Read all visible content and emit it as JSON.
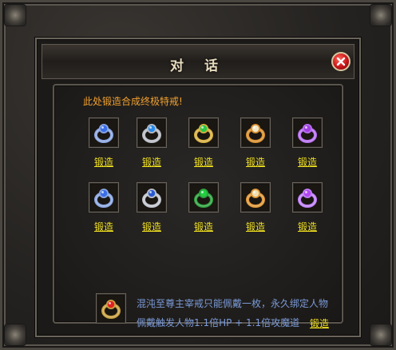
{
  "dialog": {
    "title": "对 话",
    "intro": "此处锻造合成终极特戒!",
    "rings_row1": [
      {
        "icon": "blue-ring-icon",
        "label": "锻造",
        "gem": "#3a6ee8",
        "band": "#8aa6e0"
      },
      {
        "icon": "sapphire-ring-icon",
        "label": "锻造",
        "gem": "#2a8ae8",
        "band": "#b8bcc4"
      },
      {
        "icon": "emerald-ring-icon",
        "label": "锻造",
        "gem": "#28c848",
        "band": "#d8b040"
      },
      {
        "icon": "diamond-ring-icon",
        "label": "锻造",
        "gem": "#f0e8c8",
        "band": "#d89030"
      },
      {
        "icon": "amethyst-ring-icon",
        "label": "锻造",
        "gem": "#a040e0",
        "band": "#b870f0"
      }
    ],
    "rings_row2": [
      {
        "icon": "blue-ring-icon",
        "label": "锻造",
        "gem": "#3a6ee8",
        "band": "#8aa6e0"
      },
      {
        "icon": "sapphire-ring-icon",
        "label": "锻造",
        "gem": "#2a5ad0",
        "band": "#c0c4cc"
      },
      {
        "icon": "emerald-ring-icon",
        "label": "锻造",
        "gem": "#20d040",
        "band": "#30a040"
      },
      {
        "icon": "diamond-ring-icon",
        "label": "锻造",
        "gem": "#f0e0b0",
        "band": "#e09838"
      },
      {
        "icon": "amethyst-ring-icon",
        "label": "锻造",
        "gem": "#b048f0",
        "band": "#c080f8"
      }
    ],
    "special": {
      "icon": "ruby-ring-icon",
      "line1": "混沌至尊主宰戒只能佩戴一枚，永久绑定人物",
      "line2": "佩戴触发人物1.1倍HP + 1.1倍攻魔道",
      "label": "锻造",
      "gem": "#e02020",
      "band": "#c8a040"
    }
  }
}
